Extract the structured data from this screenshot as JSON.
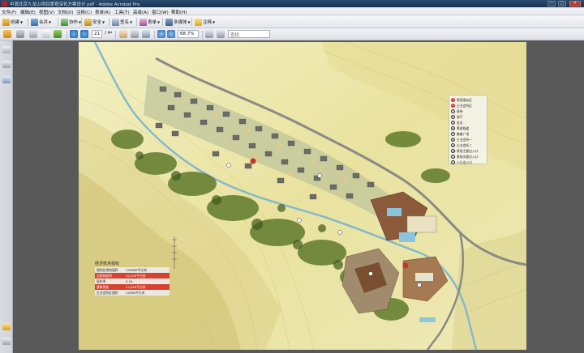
{
  "window": {
    "title": "中源北京九龙山项目景观深化方案设计.pdf - Adobe Acrobat Pro",
    "buttons": [
      "—",
      "□",
      "✕"
    ]
  },
  "menu": {
    "items": [
      "文件(F)",
      "编辑(E)",
      "视图(V)",
      "文档(D)",
      "注释(C)",
      "表单(R)",
      "工具(T)",
      "高级(A)",
      "窗口(W)",
      "帮助(H)"
    ]
  },
  "toolbar1": {
    "create": "创建",
    "combine": "合并",
    "collaborate": "协作",
    "secure": "安全",
    "sign": "签名",
    "forms": "表单",
    "multimedia": "多媒体",
    "comment": "注释"
  },
  "toolbar2": {
    "page_current": "21",
    "page_total": "/ 44",
    "zoom": "68.7%",
    "search_placeholder": "查找"
  },
  "plan": {
    "legend": [
      {
        "n": "1",
        "label": "景观酒店区",
        "style": "red"
      },
      {
        "n": "2",
        "label": "企业会所区",
        "style": "red"
      },
      {
        "n": "3",
        "label": "接待",
        "style": "white"
      },
      {
        "n": "4",
        "label": "餐厅",
        "style": "white"
      },
      {
        "n": "5",
        "label": "会议",
        "style": "white"
      },
      {
        "n": "6",
        "label": "景观栈道",
        "style": "white"
      },
      {
        "n": "7",
        "label": "集散广场",
        "style": "white"
      },
      {
        "n": "8",
        "label": "企业会所一",
        "style": "white"
      },
      {
        "n": "9",
        "label": "企业会所二",
        "style": "white"
      },
      {
        "n": "10",
        "label": "景观主要出入口",
        "style": "white"
      },
      {
        "n": "11",
        "label": "景观次要出入口",
        "style": "white"
      },
      {
        "n": "12",
        "label": "人行出入口",
        "style": "white"
      }
    ],
    "tech": {
      "title": "经济技术指标",
      "rows": [
        {
          "k": "规划总用地面积",
          "v": "134669平方米",
          "style": "g"
        },
        {
          "k": "总建筑面积",
          "v": "32,000平方米",
          "style": "r"
        },
        {
          "k": "容积率",
          "v": "0.24",
          "style": "g"
        },
        {
          "k": "建筑密度",
          "v": "12,000平方米",
          "style": "r"
        },
        {
          "k": "企业会所区面积",
          "v": "14360平方米",
          "style": "g"
        }
      ]
    }
  }
}
